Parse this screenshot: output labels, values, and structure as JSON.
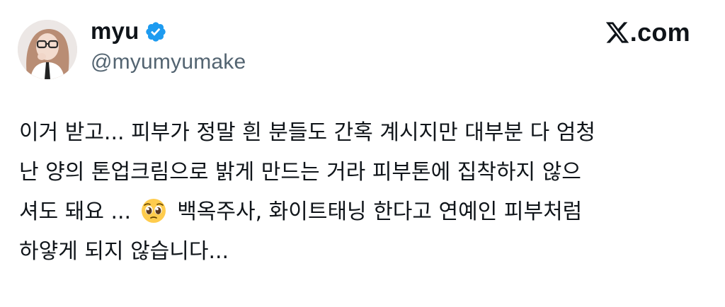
{
  "author": {
    "display_name": "myu",
    "handle": "@myumyumake",
    "verified": true,
    "avatar_icon": "profile-photo"
  },
  "brand": {
    "logo_icon": "x-logo-icon",
    "text": ".com"
  },
  "tweet": {
    "lines": [
      "이거 받고... 피부가 정말 흰 분들도 간혹 계시지만 대부분 다 엄청",
      "난 양의 톤업크림으로 밝게 만드는 거라 피부톤에 집착하지 않으",
      "셔도 돼요 ...",
      "백옥주사, 화이트태닝 한다고 연예인 피부처럼",
      "하얗게 되지 않습니다..."
    ],
    "emoji": "pleading-face-emoji"
  },
  "colors": {
    "text": "#0f1419",
    "secondary": "#536471",
    "verified": "#1d9bf0"
  }
}
